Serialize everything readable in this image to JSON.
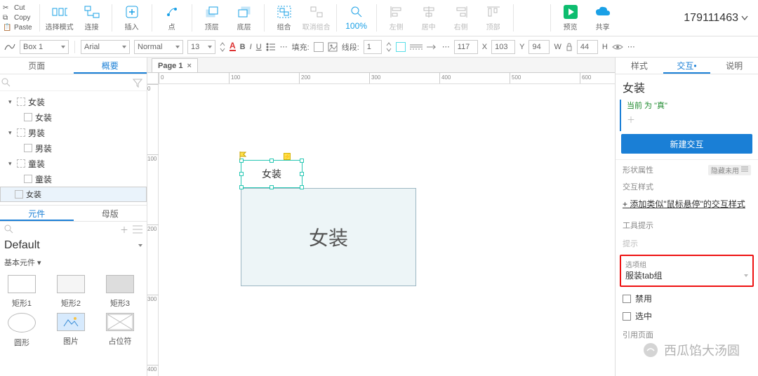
{
  "clipboard": {
    "cut": "Cut",
    "copy": "Copy",
    "paste": "Paste"
  },
  "ribbon": {
    "select_mode": "选择模式",
    "connect": "连接",
    "insert": "插入",
    "point": "点",
    "top": "顶层",
    "bottom": "底层",
    "group": "组合",
    "ungroup": "取消组合",
    "zoom": "100%",
    "left": "左侧",
    "center": "居中",
    "right": "右侧",
    "top2": "顶部",
    "preview": "预览",
    "share": "共享"
  },
  "project_id": "179111463",
  "stylebar": {
    "box": "Box 1",
    "font": "Arial",
    "weight": "Normal",
    "size": "13",
    "fill": "填充:",
    "stroke": "线段:",
    "stroke_w": "1",
    "x": "117",
    "y": "103",
    "w": "94",
    "h": "44"
  },
  "left_tabs": {
    "pages": "页面",
    "outline": "概要"
  },
  "tree": {
    "g1": "女装",
    "g1c": "女装",
    "g2": "男装",
    "g2c": "男装",
    "g3": "童装",
    "g3c": "童装",
    "cur": "女装"
  },
  "mid_tabs": {
    "widgets": "元件",
    "masters": "母版"
  },
  "lib": {
    "name": "Default",
    "cat": "基本元件 ▾",
    "r1": "矩形1",
    "r2": "矩形2",
    "r3": "矩形3",
    "r4": "圆形",
    "r5": "图片",
    "r6": "占位符"
  },
  "page_tab": "Page 1",
  "canvas": {
    "sel_label": "女装",
    "big_label": "女装"
  },
  "right_tabs": {
    "style": "样式",
    "ix": "交互",
    "notes": "说明"
  },
  "right": {
    "title": "女装",
    "current": "当前 为 \"真\"",
    "new_ix": "新建交互",
    "shape_prop": "形状属性",
    "hide_unused": "隐藏未用",
    "ix_style_head": "交互样式",
    "ix_style_link": "添加类似\"鼠标悬停\"的交互样式",
    "tooltip_head": "工具提示",
    "tooltip_ph": "提示",
    "optgroup_head": "选项组",
    "optgroup_val": "服装tab组",
    "cb_disable": "禁用",
    "cb_select": "选中",
    "ref_page": "引用页面"
  },
  "watermark": "西瓜馅大汤圆"
}
